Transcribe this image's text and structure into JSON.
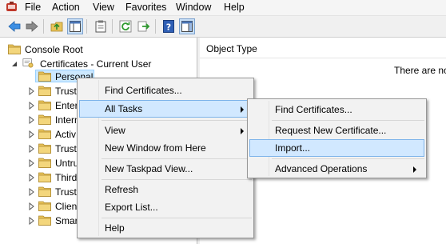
{
  "menubar": {
    "items": [
      "File",
      "Action",
      "View",
      "Favorites",
      "Window",
      "Help"
    ]
  },
  "toolbar": {
    "buttons": [
      "back-icon",
      "forward-icon",
      "up-folder-icon",
      "show-hide-tree-icon",
      "clipboard-icon",
      "refresh-icon",
      "export-list-icon",
      "help-icon",
      "show-action-pane-icon"
    ]
  },
  "tree": {
    "root": "Console Root",
    "store": "Certificates - Current User",
    "selected": "Personal",
    "children": [
      "Trust",
      "Enter",
      "Intern",
      "Activ",
      "Trust",
      "Untru",
      "Third",
      "Trust",
      "Clien",
      "Smar"
    ]
  },
  "list": {
    "column": "Object Type",
    "empty_message": "There are no"
  },
  "context_menu": {
    "find_certificates": "Find Certificates...",
    "all_tasks": "All Tasks",
    "view": "View",
    "new_window": "New Window from Here",
    "new_taskpad": "New Taskpad View...",
    "refresh": "Refresh",
    "export_list": "Export List...",
    "help": "Help"
  },
  "submenu": {
    "find_certificates": "Find Certificates...",
    "request_new": "Request New Certificate...",
    "import": "Import...",
    "advanced": "Advanced Operations"
  },
  "colors": {
    "highlight": "#d1e8ff",
    "highlight_border": "#7eb4ea",
    "selection": "#cce8ff",
    "folder": "#e8c35a"
  }
}
